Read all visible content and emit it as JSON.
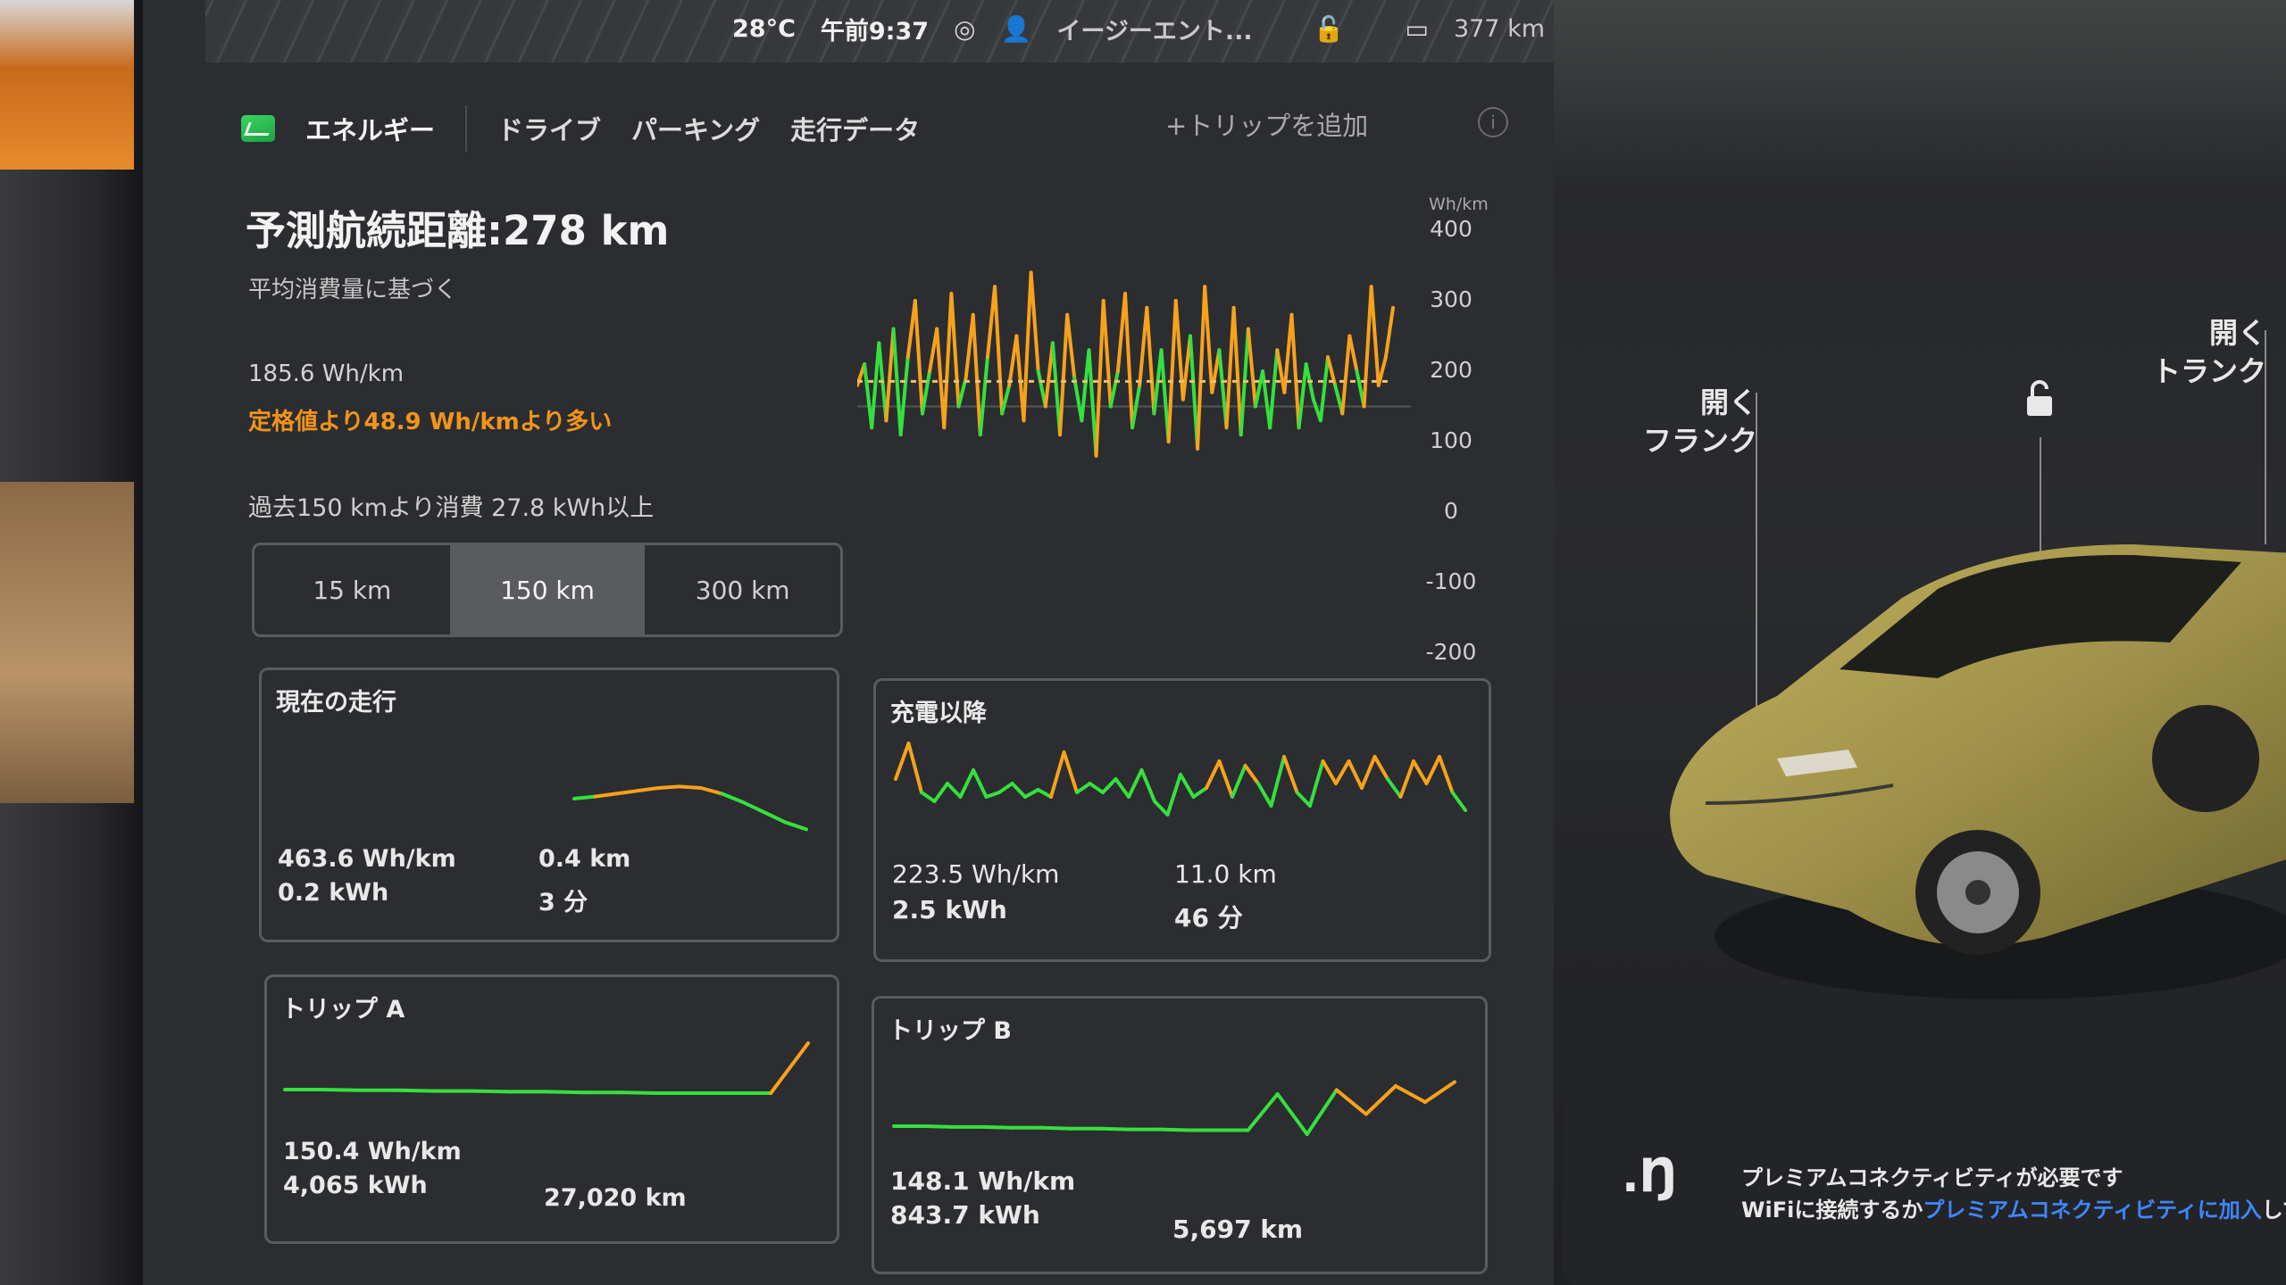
{
  "status": {
    "temperature": "28°C",
    "time": "午前9:37",
    "user": "イージーエント...",
    "range": "377 km"
  },
  "tabs": {
    "energy": "エネルギー",
    "drive": "ドライブ",
    "parking": "パーキング",
    "trip_data": "走行データ",
    "add_trip": "+トリップを追加"
  },
  "energy": {
    "range_title": "予測航続距離:278 km",
    "range_sub": "平均消費量に基づく",
    "avg_consumption": "185.6 Wh/km",
    "avg_diff": "定格値より48.9 Wh/kmより多い",
    "past_used": "過去150 kmより消費 27.8 kWh以上",
    "range_options": [
      "15 km",
      "150 km",
      "300 km"
    ],
    "selected_option": "150 km"
  },
  "chart_data": {
    "type": "line",
    "ylabel": "Wh/km",
    "yticks": [
      "400",
      "300",
      "200",
      "100",
      "0",
      "-100",
      "-200"
    ],
    "ylim": [
      -200,
      400
    ],
    "average_line": 185.6,
    "series": [
      {
        "values": [
          180,
          210,
          120,
          240,
          130,
          260,
          110,
          220,
          300,
          140,
          200,
          260,
          120,
          310,
          150,
          190,
          280,
          110,
          220,
          320,
          140,
          180,
          250,
          130,
          340,
          200,
          150,
          240,
          110,
          280,
          190,
          130,
          230,
          80,
          300,
          150,
          200,
          310,
          120,
          180,
          290,
          140,
          230,
          100,
          300,
          160,
          250,
          90,
          320,
          170,
          230,
          120,
          290,
          110,
          260,
          150,
          200,
          120,
          230,
          170,
          280,
          120,
          210,
          160,
          130,
          220,
          180,
          140,
          250,
          200,
          150,
          320,
          180,
          220,
          290
        ]
      }
    ]
  },
  "cards": {
    "current": {
      "title": "現在の走行",
      "rate": "463.6 Wh/km",
      "energy": "0.2 kWh",
      "distance": "0.4 km",
      "time": "3 分",
      "line": [
        0.45,
        0.48,
        0.52,
        0.56,
        0.6,
        0.62,
        0.6,
        0.52,
        0.4,
        0.26,
        0.12,
        0.02
      ]
    },
    "since_charge": {
      "title": "充電以降",
      "rate": "223.5 Wh/km",
      "energy": "2.5 kWh",
      "distance": "11.0 km",
      "time": "46 分",
      "line": [
        0.5,
        0.9,
        0.35,
        0.25,
        0.45,
        0.3,
        0.6,
        0.3,
        0.35,
        0.45,
        0.3,
        0.38,
        0.3,
        0.8,
        0.35,
        0.45,
        0.35,
        0.5,
        0.3,
        0.6,
        0.25,
        0.1,
        0.55,
        0.3,
        0.4,
        0.7,
        0.3,
        0.65,
        0.45,
        0.2,
        0.75,
        0.35,
        0.2,
        0.7,
        0.45,
        0.7,
        0.4,
        0.75,
        0.5,
        0.3,
        0.7,
        0.45,
        0.75,
        0.35,
        0.15
      ]
    },
    "trip_a": {
      "title": "トリップ A",
      "rate": "150.4 Wh/km",
      "energy": "4,065 kWh",
      "distance": "27,020 km",
      "line": [
        0.3,
        0.3,
        0.29,
        0.29,
        0.28,
        0.28,
        0.27,
        0.27,
        0.26,
        0.26,
        0.25,
        0.25,
        0.25,
        0.25,
        0.95
      ]
    },
    "trip_b": {
      "title": "トリップ B",
      "rate": "148.1 Wh/km",
      "energy": "843.7 kWh",
      "distance": "5,697 km",
      "line": [
        0.3,
        0.3,
        0.29,
        0.29,
        0.28,
        0.28,
        0.27,
        0.27,
        0.26,
        0.26,
        0.25,
        0.25,
        0.25,
        0.7,
        0.2,
        0.75,
        0.45,
        0.8,
        0.6,
        0.85
      ]
    }
  },
  "vehicle": {
    "frunk_label": "開く\nフランク",
    "trunk_label": "開く\nトランク"
  },
  "notice": {
    "line1": "プレミアムコネクティビティが必要です",
    "line2_prefix": "WiFiに接続するか",
    "line2_link": "プレミアムコネクティビティに加入",
    "line2_suffix": "してく"
  },
  "colors": {
    "orange": "#f7a21b",
    "green": "#35e03d",
    "link": "#3f86ff"
  }
}
